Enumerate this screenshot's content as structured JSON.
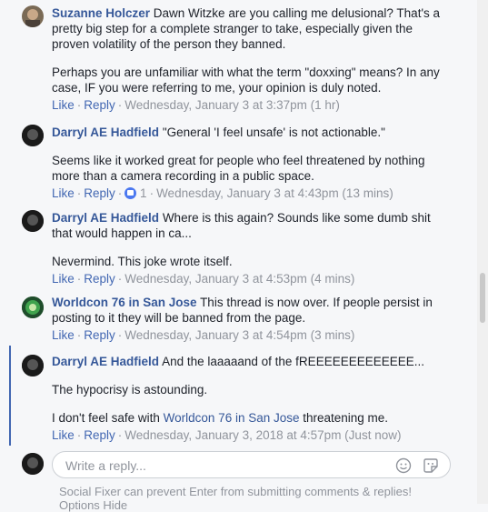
{
  "comments": [
    {
      "author": "Suzanne Holczer",
      "avatar": "avatar-photo",
      "paragraphs": [
        "Dawn Witzke are you calling me delusional? That's a pretty big step for a complete stranger to take, especially given the proven volatility of the person they banned.",
        "Perhaps you are unfamiliar with what the term \"doxxing\" means? In any case, IF you were referring to me, your opinion is duly noted."
      ],
      "like": "Like",
      "reply": "Reply",
      "timestamp": "Wednesday, January 3 at 3:37pm (1 hr)"
    },
    {
      "author": "Darryl AE Hadfield",
      "avatar": "avatar-photo",
      "paragraphs": [
        "\"General 'I feel unsafe' is not actionable.\"",
        "Seems like it worked great for people who feel threatened by nothing more than a camera recording in a public space."
      ],
      "like": "Like",
      "reply": "Reply",
      "like_count": "1",
      "timestamp": "Wednesday, January 3 at 4:43pm (13 mins)"
    },
    {
      "author": "Darryl AE Hadfield",
      "avatar": "avatar-photo",
      "paragraphs": [
        "Where is this again? Sounds like some dumb shit that would happen in ca...",
        "Nevermind. This joke wrote itself."
      ],
      "like": "Like",
      "reply": "Reply",
      "timestamp": "Wednesday, January 3 at 4:53pm (4 mins)"
    },
    {
      "author": "Worldcon 76 in San Jose",
      "avatar": "avatar-logo",
      "paragraphs": [
        "This thread is now over. If people persist in posting to it they will be banned from the page."
      ],
      "like": "Like",
      "reply": "Reply",
      "timestamp": "Wednesday, January 3 at 4:54pm (3 mins)"
    },
    {
      "author": "Darryl AE Hadfield",
      "avatar": "avatar-photo",
      "paragraphs": [
        "And the laaaaand of the fREEEEEEEEEEEEE...",
        "The hypocrisy is astounding."
      ],
      "last_pre": "I don't feel safe with ",
      "last_link": "Worldcon 76 in San Jose",
      "last_post": " threatening me.",
      "like": "Like",
      "reply": "Reply",
      "timestamp": "Wednesday, January 3, 2018 at 4:57pm (Just now)"
    }
  ],
  "reply_box": {
    "placeholder": "Write a reply...",
    "emoji_icon": "smiley-icon",
    "sticker_icon": "sticker-icon"
  },
  "footer": {
    "line1": "Social Fixer can prevent Enter from submitting comments & replies!",
    "line2": "Options Hide"
  },
  "colors": {
    "link": "#365899",
    "meta": "#90949c",
    "action": "#4267b2",
    "background": "#f6f7f9"
  }
}
